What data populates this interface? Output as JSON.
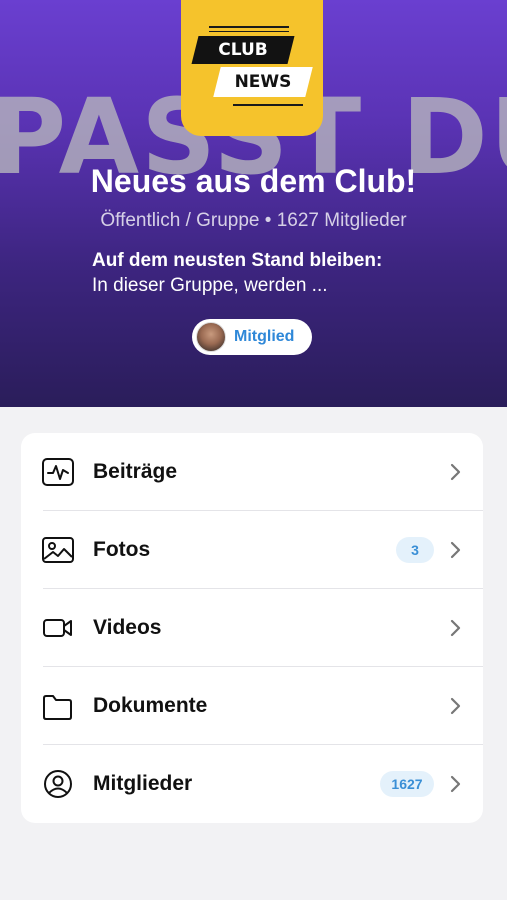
{
  "header": {
    "background_word": "PASST DU",
    "logo": {
      "line1": "CLUB",
      "line2": "NEWS"
    },
    "title": "Neues aus dem Club!",
    "meta": "Öffentlich / Gruppe • 1627 Mitglieder",
    "description_bold": "Auf dem neusten Stand bleiben:",
    "description": "In dieser Gruppe, werden ...",
    "member_button": "Mitglied"
  },
  "menu": {
    "items": [
      {
        "label": "Beiträge",
        "icon": "activity-icon",
        "badge": ""
      },
      {
        "label": "Fotos",
        "icon": "photo-icon",
        "badge": "3"
      },
      {
        "label": "Videos",
        "icon": "video-camera-icon",
        "badge": ""
      },
      {
        "label": "Dokumente",
        "icon": "folder-icon",
        "badge": ""
      },
      {
        "label": "Mitglieder",
        "icon": "user-circle-icon",
        "badge": "1627"
      }
    ]
  },
  "colors": {
    "header_top": "#6a3fd0",
    "header_bottom": "#2a1d5a",
    "logo_yellow": "#f5c32c",
    "accent_blue": "#2f88d8",
    "badge_bg": "#e4f1fb"
  }
}
